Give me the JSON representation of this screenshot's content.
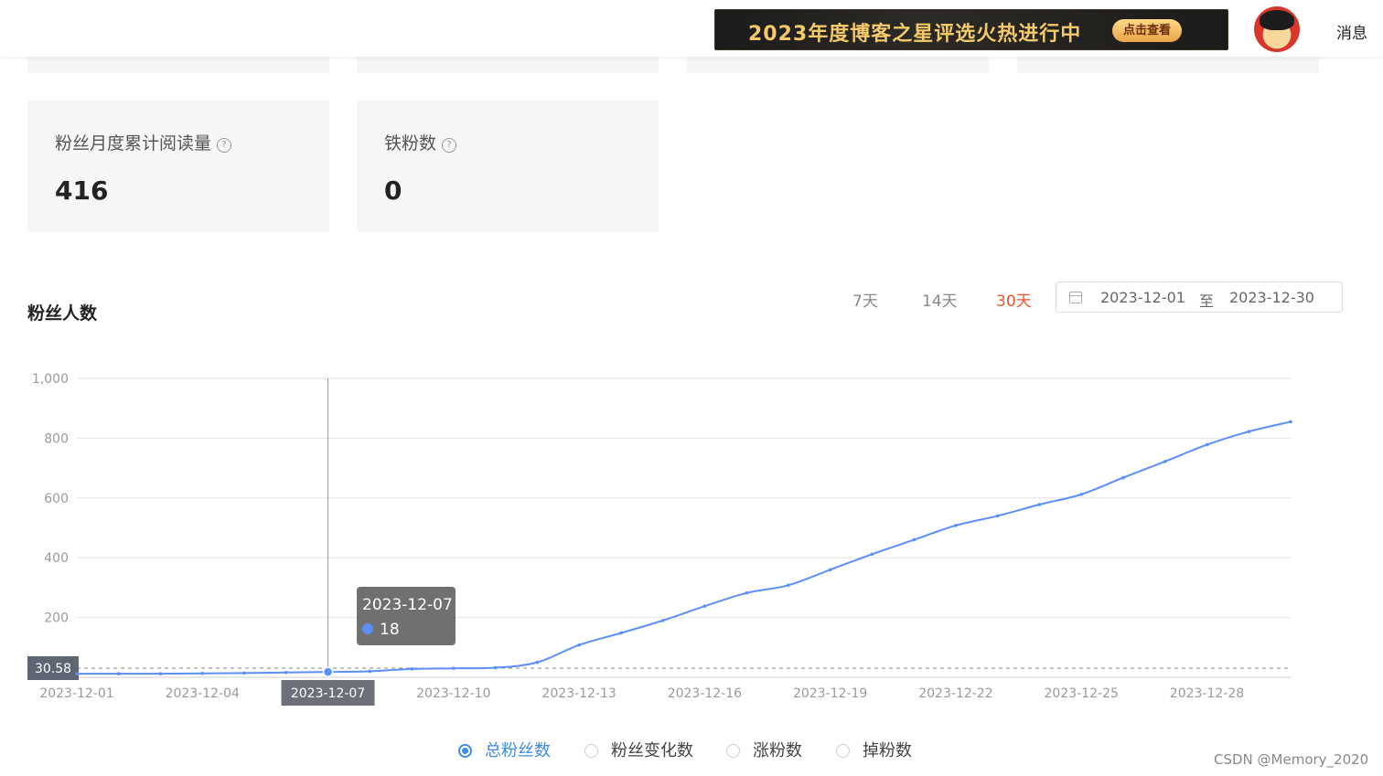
{
  "header": {
    "banner_text": "2023年度博客之星评选火热进行中",
    "banner_button": "点击查看",
    "messages_label": "消息"
  },
  "cards": [
    {
      "label": "粉丝月度累计阅读量",
      "value": "416",
      "help_icon": "question-circle-icon"
    },
    {
      "label": "铁粉数",
      "value": "0",
      "help_icon": "question-circle-icon"
    }
  ],
  "fans_section": {
    "title": "粉丝人数",
    "ranges": [
      "7天",
      "14天",
      "30天"
    ],
    "active_range": "30天",
    "date_start": "2023-12-01",
    "date_separator": "至",
    "date_end": "2023-12-30"
  },
  "legend": [
    {
      "label": "总粉丝数",
      "selected": true
    },
    {
      "label": "粉丝变化数",
      "selected": false
    },
    {
      "label": "涨粉数",
      "selected": false
    },
    {
      "label": "掉粉数",
      "selected": false
    }
  ],
  "watermark": "CSDN @Memory_2020",
  "colors": {
    "line": "#5b8ff9",
    "accent": "#f0542d",
    "legend_active": "#3e8ce8"
  },
  "chart_data": {
    "type": "line",
    "x": [
      "2023-12-01",
      "2023-12-02",
      "2023-12-03",
      "2023-12-04",
      "2023-12-05",
      "2023-12-06",
      "2023-12-07",
      "2023-12-08",
      "2023-12-09",
      "2023-12-10",
      "2023-12-11",
      "2023-12-12",
      "2023-12-13",
      "2023-12-14",
      "2023-12-15",
      "2023-12-16",
      "2023-12-17",
      "2023-12-18",
      "2023-12-19",
      "2023-12-20",
      "2023-12-21",
      "2023-12-22",
      "2023-12-23",
      "2023-12-24",
      "2023-12-25",
      "2023-12-26",
      "2023-12-27",
      "2023-12-28",
      "2023-12-29",
      "2023-12-30"
    ],
    "x_tick_labels": [
      "2023-12-01",
      "2023-12-04",
      "2023-12-07",
      "2023-12-10",
      "2023-12-13",
      "2023-12-16",
      "2023-12-19",
      "2023-12-22",
      "2023-12-25",
      "2023-12-28"
    ],
    "series": [
      {
        "name": "总粉丝数",
        "values": [
          12,
          12,
          12,
          13,
          14,
          16,
          18,
          20,
          28,
          30,
          32,
          50,
          108,
          148,
          190,
          238,
          282,
          308,
          360,
          412,
          460,
          508,
          540,
          578,
          612,
          668,
          722,
          778,
          822,
          855
        ]
      }
    ],
    "ylim": [
      0,
      1000
    ],
    "y_ticks": [
      0,
      200,
      400,
      600,
      800,
      1000
    ],
    "y_tick_labels": [
      "",
      "200",
      "400",
      "600",
      "800",
      "1,000"
    ],
    "average": 30.58,
    "average_label": "30.58",
    "grid": true,
    "tooltip": {
      "date": "2023-12-07",
      "value": "18"
    }
  }
}
